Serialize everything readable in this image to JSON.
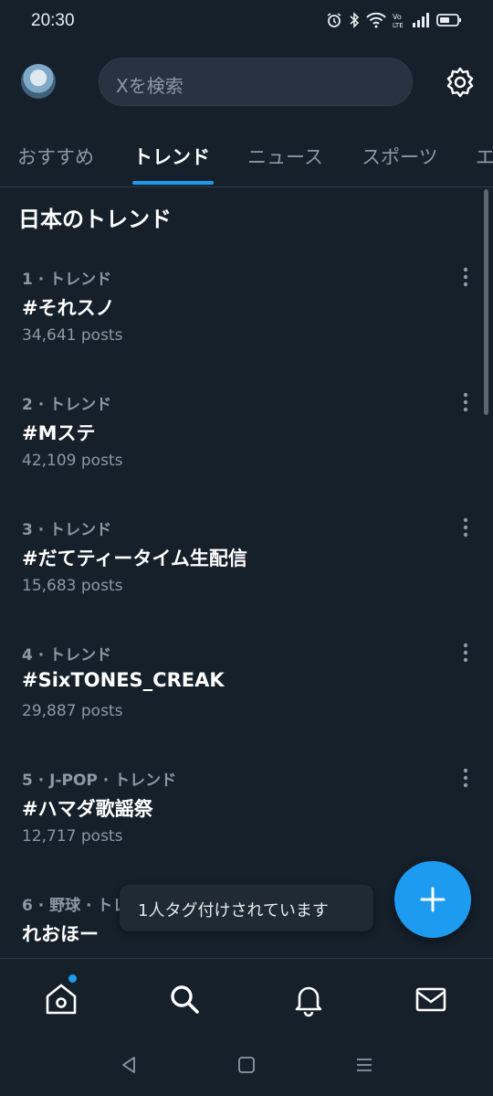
{
  "status": {
    "time": "20:30"
  },
  "search": {
    "placeholder": "Xを検索"
  },
  "tabs": [
    {
      "label": "おすすめ"
    },
    {
      "label": "トレンド"
    },
    {
      "label": "ニュース"
    },
    {
      "label": "スポーツ"
    },
    {
      "label": "エ"
    }
  ],
  "active_tab": "トレンド",
  "section_title": "日本のトレンド",
  "trends": [
    {
      "meta": "1 · トレンド",
      "name": "#それスノ",
      "count": "34,641 posts"
    },
    {
      "meta": "2 · トレンド",
      "name": "#Mステ",
      "count": "42,109 posts"
    },
    {
      "meta": "3 · トレンド",
      "name": "#だてティータイム生配信",
      "count": "15,683 posts"
    },
    {
      "meta": "4 · トレンド",
      "name": "#SixTONES_CREAK",
      "count": "29,887 posts"
    },
    {
      "meta": "5 · J-POP · トレンド",
      "name": "#ハマダ歌謡祭",
      "count": "12,717 posts"
    },
    {
      "meta": "6 · 野球 · トレ",
      "name": "れおほー",
      "count": ""
    }
  ],
  "toast": {
    "text": "1人タグ付けされています"
  },
  "colors": {
    "background": "#15202b",
    "accent": "#1d9bf0",
    "muted": "#8b98a5"
  },
  "nav": [
    "home-icon",
    "search-icon",
    "bell-icon",
    "mail-icon"
  ]
}
